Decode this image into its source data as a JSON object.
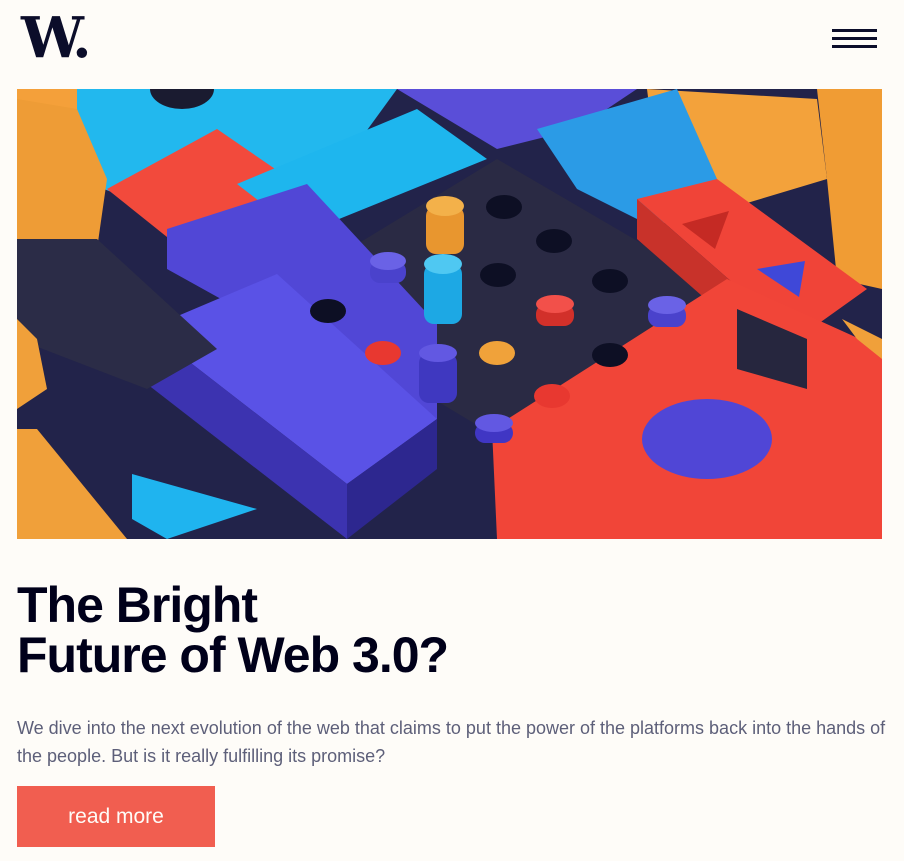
{
  "header": {
    "logo_text": "W.",
    "menu_icon": "hamburger-menu-icon"
  },
  "hero": {
    "image_subject": "3D colourful blocks and pegs"
  },
  "article": {
    "title_line1": "The Bright",
    "title_line2": "Future of Web 3.0?",
    "description": "We dive into the next evolution of the web that claims to put the power of the platforms back into the hands of the people. But is it really fulfilling its promise?",
    "cta_label": "read more"
  },
  "colors": {
    "background": "#fefcf8",
    "text_dark": "#00001a",
    "text_muted": "#5d5f79",
    "accent": "#f15e50",
    "logo": "#0b0d2a"
  }
}
